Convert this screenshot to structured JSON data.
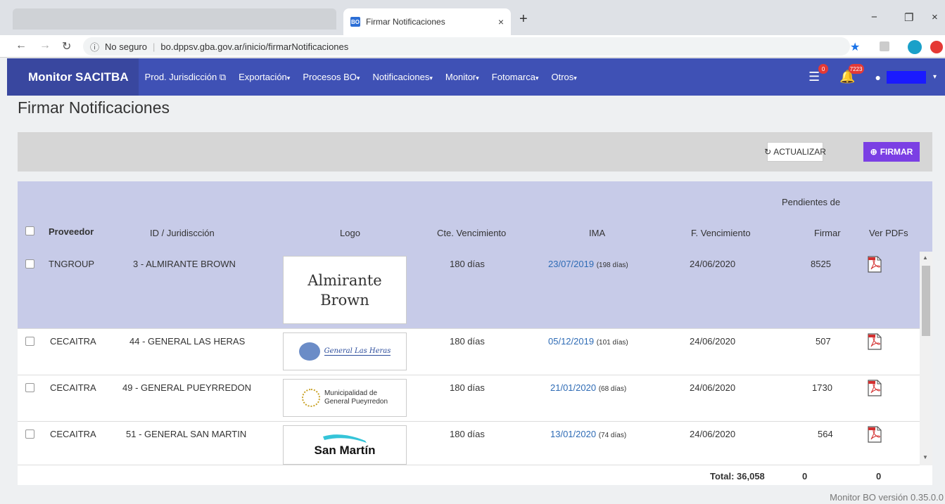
{
  "browser": {
    "tab_title": "Firmar Notificaciones",
    "tab_favicon": "BO",
    "tab_close": "×",
    "new_tab": "+",
    "security": "No seguro",
    "url": "bo.dppsv.gba.gov.ar/inicio/firmarNotificaciones",
    "win_min": "−",
    "win_max": "❐",
    "win_close": "×"
  },
  "navbar": {
    "brand": "Monitor SACITBA",
    "items": [
      {
        "label": "Prod. Jurisdicción",
        "icon": "external-link-icon"
      },
      {
        "label": "Exportación",
        "icon": "caret-down-icon"
      },
      {
        "label": "Procesos BO",
        "icon": "caret-down-icon"
      },
      {
        "label": "Notificaciones",
        "icon": "caret-down-icon"
      },
      {
        "label": "Monitor",
        "icon": "caret-down-icon"
      },
      {
        "label": "Fotomarca",
        "icon": "caret-down-icon"
      },
      {
        "label": "Otros",
        "icon": "caret-down-icon"
      }
    ],
    "tasks_badge": "0",
    "bell_badge": "7223",
    "accent": "#3f51b5"
  },
  "page": {
    "title": "Firmar Notificaciones",
    "refresh_label": "ACTUALIZAR",
    "sign_label": "FIRMAR"
  },
  "table": {
    "headers": {
      "proveedor": "Proveedor",
      "id": "ID / Juridiscción",
      "logo": "Logo",
      "cte": "Cte. Vencimiento",
      "ima": "IMA",
      "fvenc": "F. Vencimiento",
      "pend_top": "Pendientes de",
      "pend_bottom": "Firmar",
      "ver": "Ver PDFs"
    },
    "rows": [
      {
        "proveedor": "TNGROUP",
        "id": "3 - ALMIRANTE BROWN",
        "logo_text": "Almirante Brown",
        "cte": "180 días",
        "ima_date": "23/07/2019",
        "ima_days": "(198 días)",
        "fvenc": "24/06/2020",
        "pend": "8525"
      },
      {
        "proveedor": "CECAITRA",
        "id": "44 - GENERAL LAS HERAS",
        "logo_text": "General Las Heras",
        "cte": "180 días",
        "ima_date": "05/12/2019",
        "ima_days": "(101 días)",
        "fvenc": "24/06/2020",
        "pend": "507"
      },
      {
        "proveedor": "CECAITRA",
        "id": "49 - GENERAL PUEYRREDON",
        "logo_text": "Municipalidad de General Pueyrredon",
        "logo_line1": "Municipalidad de",
        "logo_line2": "General Pueyrredon",
        "cte": "180 días",
        "ima_date": "21/01/2020",
        "ima_days": "(68 días)",
        "fvenc": "24/06/2020",
        "pend": "1730"
      },
      {
        "proveedor": "CECAITRA",
        "id": "51 - GENERAL SAN MARTIN",
        "logo_text": "San Martín",
        "cte": "180 días",
        "ima_date": "13/01/2020",
        "ima_days": "(74 días)",
        "fvenc": "24/06/2020",
        "pend": "564"
      }
    ],
    "footer": {
      "total": "Total: 36,058",
      "sum1": "0",
      "sum2": "0"
    }
  },
  "version": "Monitor BO versión 0.35.0.0"
}
